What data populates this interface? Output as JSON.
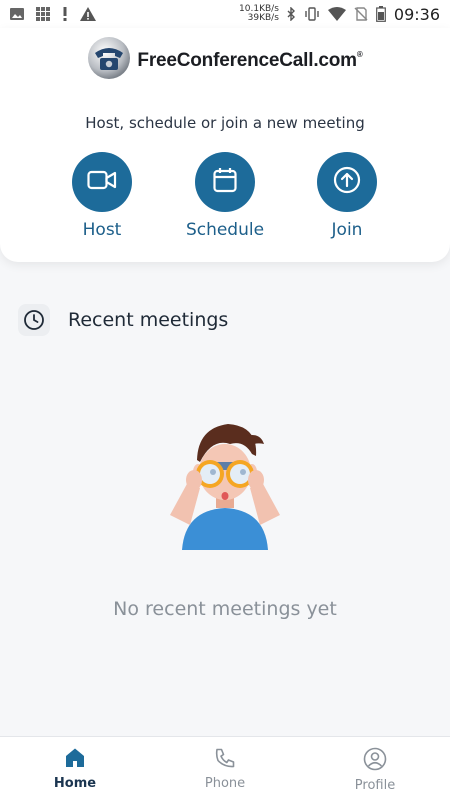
{
  "status_bar": {
    "net_up": "10.1KB/s",
    "net_down": "39KB/s",
    "time": "09:36",
    "left_icons": [
      "image-icon",
      "grid-icon",
      "alert-exclamation-icon",
      "warning-triangle-icon"
    ],
    "right_icons": [
      "bluetooth-icon",
      "vibrate-icon",
      "wifi-icon",
      "no-sim-icon",
      "battery-icon"
    ]
  },
  "header": {
    "brand": "FreeConferenceCall.com",
    "brand_mark": "®",
    "subtitle": "Host, schedule or join a new meeting"
  },
  "actions": [
    {
      "label": "Host",
      "icon": "video-camera-icon"
    },
    {
      "label": "Schedule",
      "icon": "calendar-icon"
    },
    {
      "label": "Join",
      "icon": "arrow-up-circle-icon"
    }
  ],
  "recent": {
    "title": "Recent meetings",
    "empty_message": "No recent meetings yet"
  },
  "bottom_nav": {
    "items": [
      {
        "label": "Home",
        "icon": "home-icon",
        "active": true
      },
      {
        "label": "Phone",
        "icon": "phone-icon",
        "active": false
      },
      {
        "label": "Profile",
        "icon": "user-icon",
        "active": false
      }
    ]
  },
  "colors": {
    "primary": "#1d6b9a",
    "nav_active": "#1b3550",
    "muted": "#8a9199",
    "background": "#f6f7f9"
  }
}
